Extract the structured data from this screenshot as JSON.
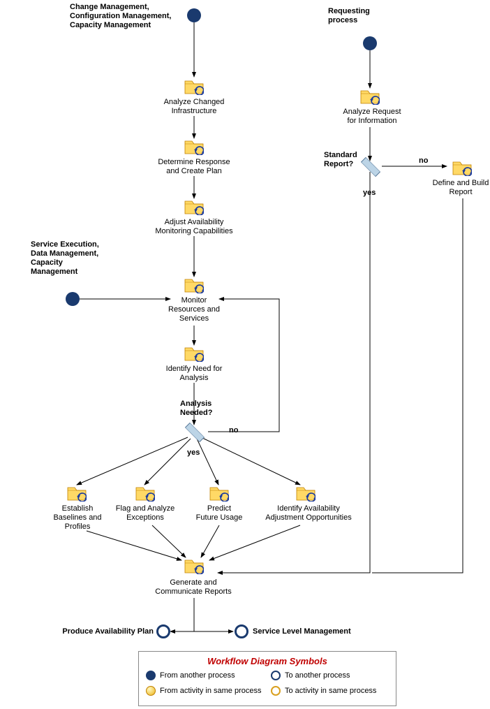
{
  "chart_data": {
    "type": "flowchart",
    "title": "Availability Management Workflow",
    "nodes": [
      {
        "id": "start_cm",
        "type": "start-process",
        "label": "Change Management,\nConfiguration Management,\nCapacity Management"
      },
      {
        "id": "start_req",
        "type": "start-process",
        "label": "Requesting\nprocess"
      },
      {
        "id": "analyze_infra",
        "type": "activity",
        "label": "Analyze Changed\nInfrastructure"
      },
      {
        "id": "determine_response",
        "type": "activity",
        "label": "Determine Response\nand Create Plan"
      },
      {
        "id": "adjust_avail",
        "type": "activity",
        "label": "Adjust Availability\nMonitoring Capabilities"
      },
      {
        "id": "start_se",
        "type": "start-process",
        "label": "Service Execution,\nData Management,\nCapacity\nManagement"
      },
      {
        "id": "monitor",
        "type": "activity",
        "label": "Monitor\nResources and\nServices"
      },
      {
        "id": "identify_need",
        "type": "activity",
        "label": "Identify Need for\nAnalysis"
      },
      {
        "id": "dec_analysis",
        "type": "decision",
        "label": "Analysis\nNeeded?"
      },
      {
        "id": "establish",
        "type": "activity",
        "label": "Establish\nBaselines and\nProfiles"
      },
      {
        "id": "flag",
        "type": "activity",
        "label": "Flag and Analyze\nExceptions"
      },
      {
        "id": "predict",
        "type": "activity",
        "label": "Predict\nFuture Usage"
      },
      {
        "id": "identify_avail",
        "type": "activity",
        "label": "Identify Availability\nAdjustment Opportunities"
      },
      {
        "id": "generate",
        "type": "activity",
        "label": "Generate and\nCommunicate Reports"
      },
      {
        "id": "end_plan",
        "type": "end-process",
        "label": "Produce Availability Plan"
      },
      {
        "id": "end_slm",
        "type": "end-process",
        "label": "Service Level Management"
      },
      {
        "id": "analyze_req",
        "type": "activity",
        "label": "Analyze Request\nfor Information"
      },
      {
        "id": "dec_standard",
        "type": "decision",
        "label": "Standard\nReport?"
      },
      {
        "id": "define_build",
        "type": "activity",
        "label": "Define and Build\nReport"
      }
    ],
    "edges": [
      {
        "from": "start_cm",
        "to": "analyze_infra"
      },
      {
        "from": "analyze_infra",
        "to": "determine_response"
      },
      {
        "from": "determine_response",
        "to": "adjust_avail"
      },
      {
        "from": "adjust_avail",
        "to": "monitor"
      },
      {
        "from": "start_se",
        "to": "monitor"
      },
      {
        "from": "monitor",
        "to": "identify_need"
      },
      {
        "from": "identify_need",
        "to": "dec_analysis"
      },
      {
        "from": "dec_analysis",
        "to": "monitor",
        "label": "no"
      },
      {
        "from": "dec_analysis",
        "to": "establish",
        "label": "yes"
      },
      {
        "from": "dec_analysis",
        "to": "flag",
        "label": "yes"
      },
      {
        "from": "dec_analysis",
        "to": "predict",
        "label": "yes"
      },
      {
        "from": "dec_analysis",
        "to": "identify_avail",
        "label": "yes"
      },
      {
        "from": "establish",
        "to": "generate"
      },
      {
        "from": "flag",
        "to": "generate"
      },
      {
        "from": "predict",
        "to": "generate"
      },
      {
        "from": "identify_avail",
        "to": "generate"
      },
      {
        "from": "generate",
        "to": "end_plan"
      },
      {
        "from": "generate",
        "to": "end_slm"
      },
      {
        "from": "start_req",
        "to": "analyze_req"
      },
      {
        "from": "analyze_req",
        "to": "dec_standard"
      },
      {
        "from": "dec_standard",
        "to": "generate",
        "label": "yes"
      },
      {
        "from": "dec_standard",
        "to": "define_build",
        "label": "no"
      },
      {
        "from": "define_build",
        "to": "generate"
      }
    ],
    "legend": {
      "title": "Workflow Diagram Symbols",
      "items": [
        {
          "symbol": "solid-blue-circle",
          "label": "From another process"
        },
        {
          "symbol": "ring-blue-circle",
          "label": "To another process"
        },
        {
          "symbol": "solid-yellow-circle",
          "label": "From activity in same process"
        },
        {
          "symbol": "ring-yellow-circle",
          "label": "To activity in same process"
        }
      ]
    }
  },
  "labels": {
    "start_cm": "Change Management,\nConfiguration Management,\nCapacity Management",
    "start_req": "Requesting\nprocess",
    "analyze_infra": "Analyze Changed\nInfrastructure",
    "determine_response": "Determine Response\nand Create Plan",
    "adjust_avail": "Adjust Availability\nMonitoring Capabilities",
    "start_se": "Service Execution,\nData Management,\nCapacity\nManagement",
    "monitor": "Monitor\nResources and\nServices",
    "identify_need": "Identify Need for\nAnalysis",
    "dec_analysis": "Analysis\nNeeded?",
    "establish": "Establish\nBaselines and\nProfiles",
    "flag": "Flag and Analyze\nExceptions",
    "predict": "Predict\nFuture Usage",
    "identify_avail": "Identify Availability\nAdjustment Opportunities",
    "generate": "Generate and\nCommunicate Reports",
    "end_plan": "Produce Availability Plan",
    "end_slm": "Service Level Management",
    "analyze_req": "Analyze Request\nfor Information",
    "dec_standard": "Standard\nReport?",
    "define_build": "Define and Build\nReport",
    "yes": "yes",
    "no": "no"
  },
  "legend": {
    "title": "Workflow Diagram Symbols",
    "from_another": "From another process",
    "to_another": "To another process",
    "from_same": "From activity in same process",
    "to_same": "To activity in same process"
  }
}
